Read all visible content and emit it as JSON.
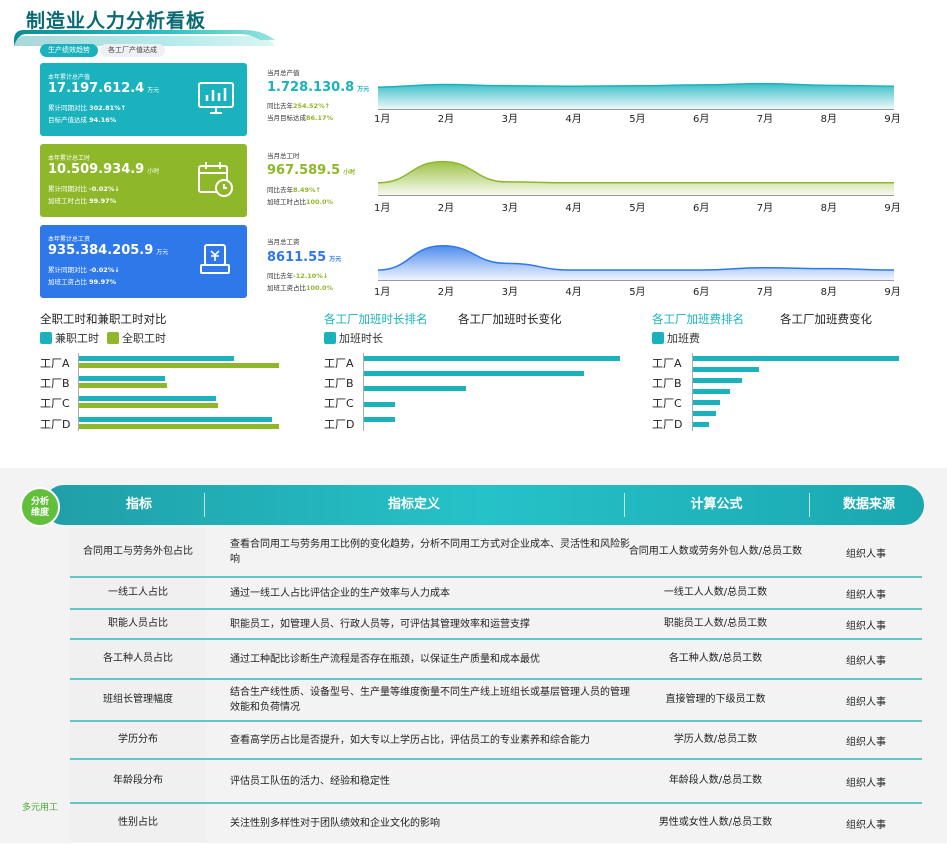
{
  "header": {
    "title": "制造业人力分析看板"
  },
  "tabs": [
    {
      "label": "生产绩效趋势",
      "active": true
    },
    {
      "label": "各工厂产值达成",
      "active": false
    }
  ],
  "colors": {
    "teal": "#19b2bd",
    "green": "#8eb82a",
    "blue": "#2f78ea",
    "brand": "#0a6a74"
  },
  "kpi_cards": [
    {
      "label": "本年累计总产值",
      "value": "17.197.612.4",
      "unit": "万元",
      "line1_label": "累计同期对比",
      "line1_value": "302.81%↑",
      "line2_label": "目标产值达成",
      "line2_value": "94.16%",
      "color": "#19b2bd",
      "icon": "monitor-chart-icon"
    },
    {
      "label": "本年累计总工时",
      "value": "10.509.934.9",
      "unit": "小时",
      "line1_label": "累计同期对比",
      "line1_value": "-0.02%↓",
      "line2_label": "加班工时占比",
      "line2_value": "99.97%",
      "color": "#8eb82a",
      "icon": "calendar-clock-icon"
    },
    {
      "label": "本年累计总工资",
      "value": "935.384.205.9",
      "unit": "万元",
      "line1_label": "累计同期对比",
      "line1_value": "-0.02%↓",
      "line2_label": "加班工资占比",
      "line2_value": "99.97%",
      "color": "#2f78ea",
      "icon": "cash-register-icon"
    }
  ],
  "monthly": [
    {
      "label": "当月总产值",
      "value": "1.728.130.8",
      "unit": "万元",
      "sub1_label": "同比去年",
      "sub1_value": "254.52%↑",
      "sub2_label": "当月目标达成",
      "sub2_value": "86.17%",
      "color": "#19b2bd"
    },
    {
      "label": "当月总工时",
      "value": "967.589.5",
      "unit": "小时",
      "sub1_label": "同比去年",
      "sub1_value": "8.49%↑",
      "sub2_label": "加班工时占比",
      "sub2_value": "100.0%",
      "color": "#8eb82a"
    },
    {
      "label": "当月总工资",
      "value": "8611.55",
      "unit": "万元",
      "sub1_label": "同比去年",
      "sub1_value": "-12.10%↓",
      "sub2_label": "加班工资占比",
      "sub2_value": "100.0%",
      "color": "#2f78ea"
    }
  ],
  "months": [
    "1月",
    "2月",
    "3月",
    "4月",
    "5月",
    "6月",
    "7月",
    "8月",
    "9月"
  ],
  "chart_data": [
    {
      "type": "area",
      "x": [
        "1月",
        "2月",
        "3月",
        "4月",
        "5月",
        "6月",
        "7月",
        "8月",
        "9月"
      ],
      "series": [
        {
          "values": [
            52,
            58,
            55,
            54,
            55,
            57,
            60,
            56,
            54
          ]
        }
      ],
      "color": "#19b2bd"
    },
    {
      "type": "area",
      "x": [
        "1月",
        "2月",
        "3月",
        "4月",
        "5月",
        "6月",
        "7月",
        "8月",
        "9月"
      ],
      "series": [
        {
          "values": [
            30,
            78,
            32,
            30,
            30,
            30,
            30,
            30,
            30
          ]
        }
      ],
      "color": "#8eb82a"
    },
    {
      "type": "area",
      "x": [
        "1月",
        "2月",
        "3月",
        "4月",
        "5月",
        "6月",
        "7月",
        "8月",
        "9月"
      ],
      "series": [
        {
          "values": [
            25,
            80,
            40,
            25,
            25,
            25,
            30,
            28,
            25
          ]
        }
      ],
      "color": "#2f78ea"
    },
    {
      "type": "bar",
      "orientation": "horizontal",
      "title": "全职工时和兼职工时对比",
      "categories": [
        "工厂A",
        "工厂B",
        "工厂C",
        "工厂D"
      ],
      "series": [
        {
          "name": "兼职工时",
          "values": [
            74,
            41,
            65,
            92
          ],
          "color": "#19b2bd"
        },
        {
          "name": "全职工时",
          "values": [
            95,
            42,
            66,
            95
          ],
          "color": "#8eb82a"
        }
      ]
    },
    {
      "type": "bar",
      "orientation": "horizontal",
      "title": "各工厂加班时长排名",
      "categories": [
        "工厂A",
        "工厂B",
        "工厂C",
        "工厂D"
      ],
      "series": [
        {
          "name": "加班时长",
          "values": [
            100,
            86,
            40,
            12
          ],
          "color": "#19b2bd"
        }
      ]
    },
    {
      "type": "bar",
      "orientation": "horizontal",
      "title": "各工厂加班费排名",
      "categories": [
        "工厂A",
        "工厂B",
        "工厂C",
        "工厂D"
      ],
      "series": [
        {
          "name": "加班费",
          "values": [
            100,
            32,
            24,
            18,
            13,
            11,
            8
          ],
          "color": "#19b2bd"
        }
      ]
    }
  ],
  "bar_sections": [
    {
      "title": "全职工时和兼职工时对比",
      "title2": "",
      "legend": [
        "兼职工时",
        "全职工时"
      ]
    },
    {
      "title": "各工厂加班时长排名",
      "title2": "各工厂加班时长变化",
      "legend": [
        "加班时长"
      ]
    },
    {
      "title": "各工厂加班费排名",
      "title2": "各工厂加班费变化",
      "legend": [
        "加班费"
      ]
    }
  ],
  "factories": [
    "工厂A",
    "工厂B",
    "工厂C",
    "工厂D"
  ],
  "table": {
    "badge": [
      "分析",
      "维度"
    ],
    "side_label": "多元用工",
    "headers": [
      "指标",
      "指标定义",
      "计算公式",
      "数据来源"
    ],
    "rows": [
      {
        "name": "合同用工与劳务外包占比",
        "definition": "查看合同用工与劳务用工比例的变化趋势，分析不同用工方式对企业成本、灵活性和风险影响",
        "formula": "合同用工人数或劳务外包人数/总员工数",
        "source": "组织人事"
      },
      {
        "name": "一线工人占比",
        "definition": "通过一线工人占比评估企业的生产效率与人力成本",
        "formula": "一线工人人数/总员工数",
        "source": "组织人事"
      },
      {
        "name": "职能人员占比",
        "definition": "职能员工，如管理人员、行政人员等，可评估其管理效率和运营支撑",
        "formula": "职能员工人数/总员工数",
        "source": "组织人事"
      },
      {
        "name": "各工种人员占比",
        "definition": "通过工种配比诊断生产流程是否存在瓶颈，以保证生产质量和成本最优",
        "formula": "各工种人数/总员工数",
        "source": "组织人事"
      },
      {
        "name": "班组长管理幅度",
        "definition": "结合生产线性质、设备型号、生产量等维度衡量不同生产线上班组长或基层管理人员的管理效能和负荷情况",
        "formula": "直接管理的下级员工数",
        "source": "组织人事"
      },
      {
        "name": "学历分布",
        "definition": "查看高学历占比是否提升，如大专以上学历占比，评估员工的专业素养和综合能力",
        "formula": "学历人数/总员工数",
        "source": "组织人事"
      },
      {
        "name": "年龄段分布",
        "definition": "评估员工队伍的活力、经验和稳定性",
        "formula": "年龄段人数/总员工数",
        "source": "组织人事"
      },
      {
        "name": "性别占比",
        "definition": "关注性别多样性对于团队绩效和企业文化的影响",
        "formula": "男性或女性人数/总员工数",
        "source": "组织人事"
      }
    ]
  }
}
